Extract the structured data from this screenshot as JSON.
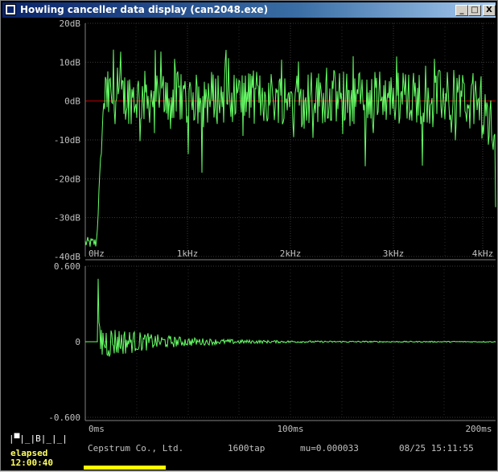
{
  "window": {
    "title": "Howling canceller data display (can2048.exe)"
  },
  "controls": {
    "minimize": "_",
    "maximize": "□",
    "close": "X"
  },
  "spectrum": {
    "ytick_labels": [
      "20dB",
      "10dB",
      "0dB",
      "-10dB",
      "-20dB",
      "-30dB",
      "-40dB"
    ],
    "xtick_labels": [
      "0Hz",
      "1kHz",
      "2kHz",
      "3kHz",
      "4kHz"
    ],
    "ylim": [
      -40,
      20
    ],
    "zero_line_color": "#c00000",
    "trace_color": "#66ff66"
  },
  "impulse": {
    "ytick_labels": [
      "0.600",
      "0",
      "-0.600"
    ],
    "xtick_labels": [
      "0ms",
      "100ms",
      "200ms"
    ],
    "ylim": [
      -0.6,
      0.6
    ],
    "trace_color": "#66ff66"
  },
  "status": {
    "mode_boxes": "|▀|_|B|_|_|",
    "elapsed_label": "elapsed",
    "elapsed_time": "12:00:40",
    "company": "Cepstrum Co., Ltd.",
    "taps": "1600tap",
    "mu": "mu=0.000033",
    "datetime": "08/25 15:11:55"
  }
}
